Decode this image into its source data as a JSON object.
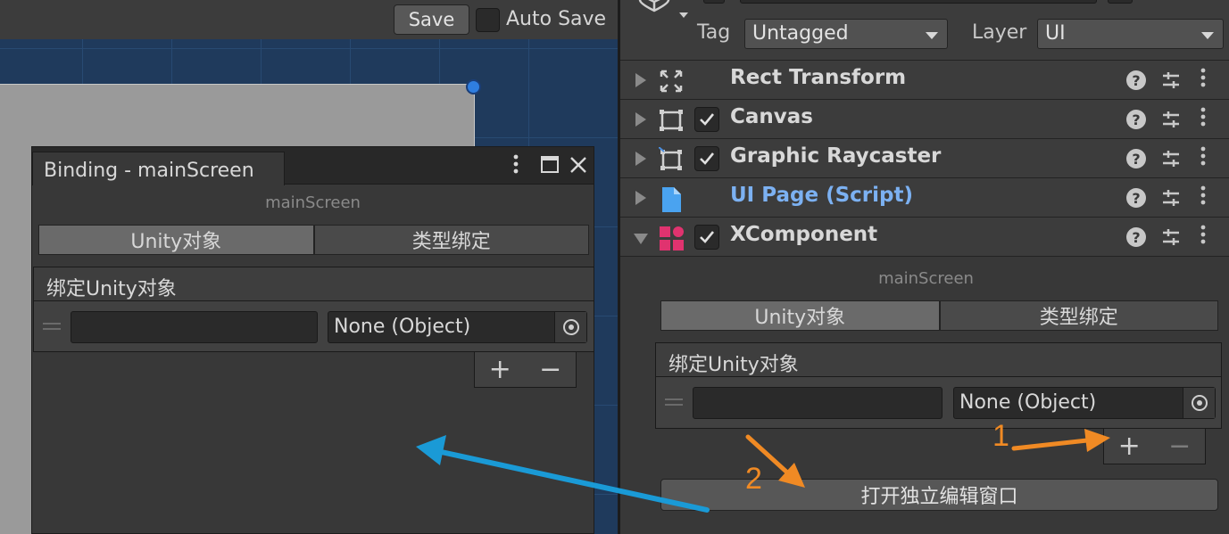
{
  "toolbar": {
    "save_label": "Save",
    "auto_save_label": "Auto Save"
  },
  "binding_window": {
    "tab_title": "Binding - mainScreen",
    "object_name": "mainScreen",
    "tabs": [
      "Unity对象",
      "类型绑定"
    ],
    "active_tab": 0,
    "list_header": "绑定Unity对象",
    "row": {
      "name_value": "",
      "object_value": "None (Object)"
    },
    "add_label": "+",
    "remove_label": "−"
  },
  "inspector": {
    "tag_label": "Tag",
    "tag_value": "Untagged",
    "layer_label": "Layer",
    "layer_value": "UI",
    "components": [
      {
        "name": "Rect Transform",
        "icon": "rect-transform-icon",
        "has_checkbox": false,
        "expanded": false
      },
      {
        "name": "Canvas",
        "icon": "canvas-icon",
        "has_checkbox": true,
        "checked": true,
        "expanded": false
      },
      {
        "name": "Graphic Raycaster",
        "icon": "raycaster-icon",
        "has_checkbox": true,
        "checked": true,
        "expanded": false
      },
      {
        "name": "UI Page (Script)",
        "icon": "script-file-icon",
        "has_checkbox": false,
        "expanded": false
      },
      {
        "name": "XComponent",
        "icon": "xcomponent-icon",
        "has_checkbox": true,
        "checked": true,
        "expanded": true
      }
    ],
    "xcomponent": {
      "object_name": "mainScreen",
      "tabs": [
        "Unity对象",
        "类型绑定"
      ],
      "active_tab": 0,
      "list_header": "绑定Unity对象",
      "row": {
        "name_value": "",
        "object_value": "None (Object)"
      },
      "add_label": "+",
      "remove_label": "−",
      "open_window_label": "打开独立编辑窗口"
    }
  },
  "annotations": {
    "step1": "1",
    "step2": "2",
    "orange": "#f08a24",
    "blue": "#1a9ad6"
  },
  "colors": {
    "script_link": "#7cb1f2",
    "xcomponent_icon": "#e0336f",
    "scene_background": "#1f3a5c"
  }
}
